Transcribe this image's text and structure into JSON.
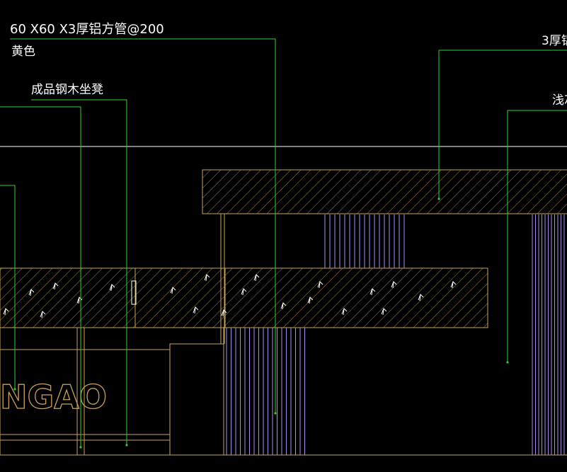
{
  "annotations": {
    "tube_spec": "60 X60 X3厚铝方管@200",
    "tube_color": "黄色",
    "bench": "成品钢木坐凳",
    "right_top": "3厚铝",
    "right_mid": "浅灰"
  },
  "logo_text": "NGAO",
  "colors": {
    "background": "#000000",
    "outline": "#c8a25a",
    "hatch": "#a8864a",
    "leader": "#2fd12f",
    "purple_lines": "#a98bea",
    "white_line": "#ffffff",
    "text": "#ffffff",
    "logo": "#c8a25a"
  }
}
